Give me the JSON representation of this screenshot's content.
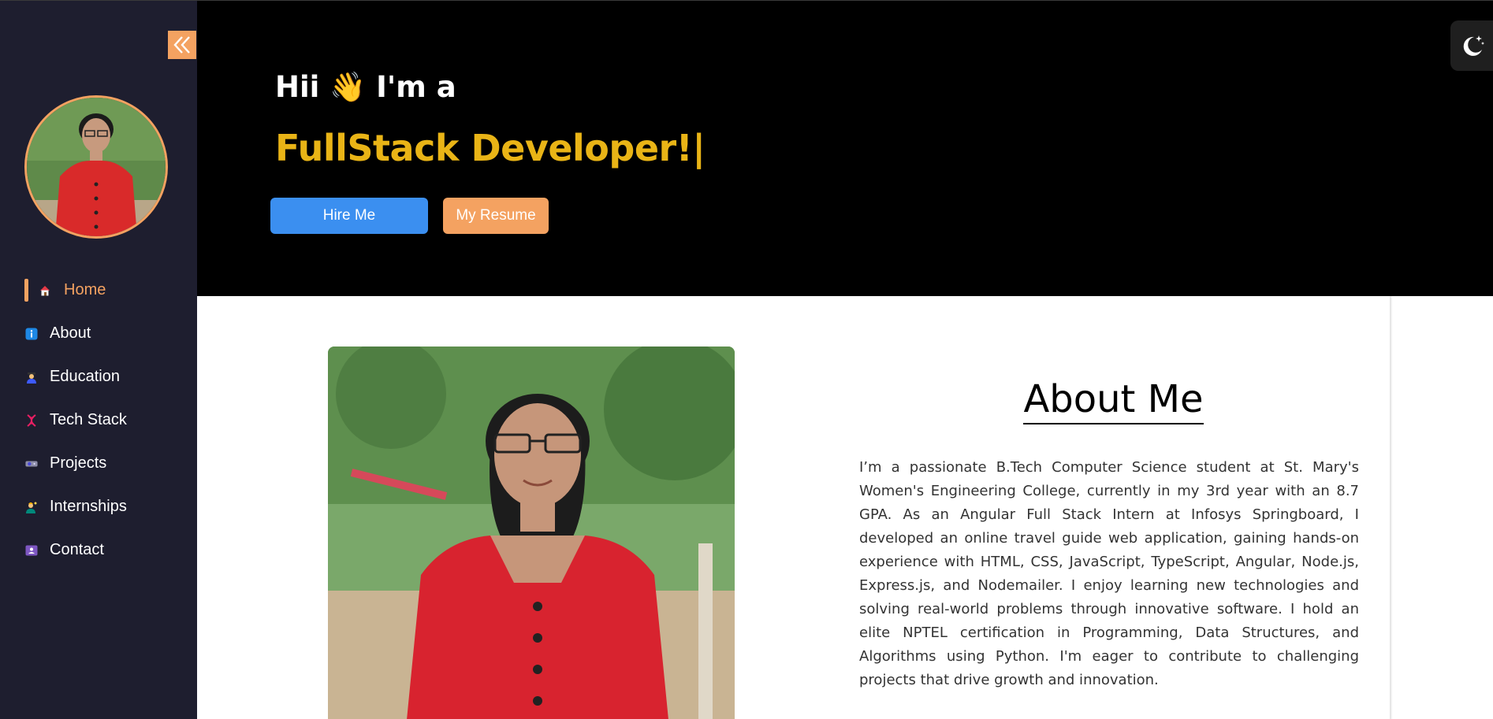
{
  "sidebar": {
    "items": [
      {
        "label": "Home",
        "icon": "home-icon",
        "active": true
      },
      {
        "label": "About",
        "icon": "info-icon"
      },
      {
        "label": "Education",
        "icon": "student-icon"
      },
      {
        "label": "Tech Stack",
        "icon": "dna-icon"
      },
      {
        "label": "Projects",
        "icon": "projector-icon"
      },
      {
        "label": "Internships",
        "icon": "worker-icon"
      },
      {
        "label": "Contact",
        "icon": "contact-card-icon"
      }
    ]
  },
  "hero": {
    "greeting": "Hii 👋 I'm a",
    "role": "FullStack Developer!",
    "caret": "|",
    "hire_label": "Hire Me",
    "resume_label": "My Resume"
  },
  "about": {
    "title": "About Me",
    "text": "I’m a passionate B.Tech Computer Science student at St. Mary's Women's Engineering College, currently in my 3rd year with an 8.7 GPA. As an Angular Full Stack Intern at Infosys Springboard, I developed an online travel guide web application, gaining hands-on experience with HTML, CSS, JavaScript, TypeScript, Angular, Node.js, Express.js, and Nodemailer. I enjoy learning new technologies and solving real-world problems through innovative software. I hold an elite NPTEL certification in Programming, Data Structures, and Algorithms using Python. I'm eager to contribute to challenging projects that drive growth and innovation."
  },
  "colors": {
    "sidebar_bg": "#1e1e2f",
    "accent": "#f4a261",
    "role_text": "#e9b416",
    "hire_button": "#3b8ff0",
    "hero_bg": "#000000"
  }
}
